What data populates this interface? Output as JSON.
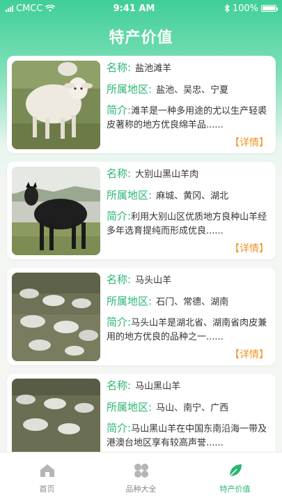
{
  "status": {
    "carrier": "CMCC",
    "time": "9:41 AM",
    "battery": "100%"
  },
  "page": {
    "title": "特产价值"
  },
  "labels": {
    "name": "名称:",
    "region": "所属地区:",
    "intro": "简介:",
    "detail": "【详情】"
  },
  "items": [
    {
      "name": "盐池滩羊",
      "region": "盐池、吴忠、宁夏",
      "intro": "滩羊是一种多用途的尤以生产轻裘皮著称的地方优良绵羊品......",
      "image": "white-sheep"
    },
    {
      "name": "大别山黑山羊肉",
      "region": "麻城、黄冈、湖北",
      "intro": "利用大别山区优质地方良种山羊经多年选育提纯而形成优良......",
      "image": "black-goat"
    },
    {
      "name": "马头山羊",
      "region": "石门、常德、湖南",
      "intro": "马头山羊是湖北省、湖南省肉皮兼用的地方优良的品种之一......",
      "image": "goat-flock"
    },
    {
      "name": "马山黑山羊",
      "region": "马山、南宁、广西",
      "intro": "马山黑山羊在中国东南沿海一带及港澳台地区享有较高声誉......",
      "image": "goat-flock"
    }
  ],
  "tabs": [
    {
      "label": "首页",
      "icon": "home-icon",
      "active": false
    },
    {
      "label": "品种大全",
      "icon": "grid-icon",
      "active": false
    },
    {
      "label": "特产价值",
      "icon": "leaf-icon",
      "active": true
    }
  ],
  "colors": {
    "accent": "#2bb673",
    "detail": "#f29423",
    "header": "#3fcf98"
  }
}
